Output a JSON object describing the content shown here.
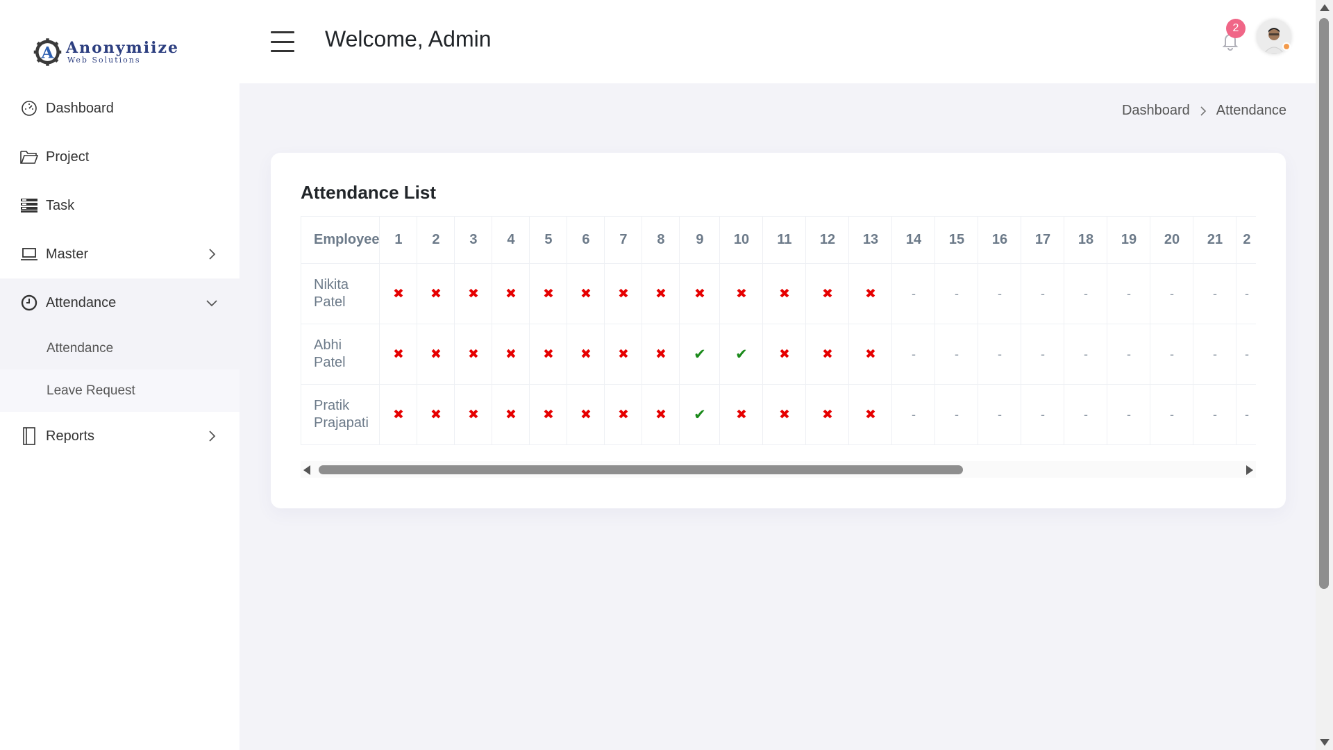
{
  "brand": {
    "name": "Anonymiize",
    "tagline": "Web Solutions"
  },
  "header": {
    "welcome": "Welcome, Admin",
    "notification_count": "2"
  },
  "sidebar": {
    "items": [
      {
        "label": "Dashboard",
        "icon": "dashboard-gauge-icon"
      },
      {
        "label": "Project",
        "icon": "folder-open-icon"
      },
      {
        "label": "Task",
        "icon": "server-stack-icon"
      },
      {
        "label": "Master",
        "icon": "laptop-icon"
      },
      {
        "label": "Attendance",
        "icon": "clock-icon",
        "expanded": true,
        "subitems": [
          {
            "label": "Attendance"
          },
          {
            "label": "Leave Request"
          }
        ]
      },
      {
        "label": "Reports",
        "icon": "book-icon"
      }
    ]
  },
  "breadcrumb": {
    "home": "Dashboard",
    "current": "Attendance"
  },
  "attendance": {
    "title": "Attendance List",
    "employee_header": "Employee",
    "days": [
      "1",
      "2",
      "3",
      "4",
      "5",
      "6",
      "7",
      "8",
      "9",
      "10",
      "11",
      "12",
      "13",
      "14",
      "15",
      "16",
      "17",
      "18",
      "19",
      "20",
      "21",
      "2"
    ],
    "rows": [
      {
        "name_first": "Nikita",
        "name_last": "Patel",
        "marks": [
          "x",
          "x",
          "x",
          "x",
          "x",
          "x",
          "x",
          "x",
          "x",
          "x",
          "x",
          "x",
          "x",
          "-",
          "-",
          "-",
          "-",
          "-",
          "-",
          "-",
          "-",
          "-"
        ]
      },
      {
        "name_first": "Abhi",
        "name_last": "Patel",
        "marks": [
          "x",
          "x",
          "x",
          "x",
          "x",
          "x",
          "x",
          "x",
          "v",
          "v",
          "x",
          "x",
          "x",
          "-",
          "-",
          "-",
          "-",
          "-",
          "-",
          "-",
          "-",
          "-"
        ]
      },
      {
        "name_first": "Pratik",
        "name_last": "Prajapati",
        "marks": [
          "x",
          "x",
          "x",
          "x",
          "x",
          "x",
          "x",
          "x",
          "v",
          "x",
          "x",
          "x",
          "x",
          "-",
          "-",
          "-",
          "-",
          "-",
          "-",
          "-",
          "-",
          "-"
        ]
      }
    ],
    "symbols": {
      "absent": "✖",
      "present": "✔",
      "none": "-"
    },
    "colors": {
      "absent": "#e60000",
      "present": "#1a8a1a",
      "none": "#8a96a3"
    }
  },
  "colors": {
    "accent_badge": "#f06687",
    "brand_blue": "#2d3f80",
    "status_dot": "#f39a4b"
  }
}
